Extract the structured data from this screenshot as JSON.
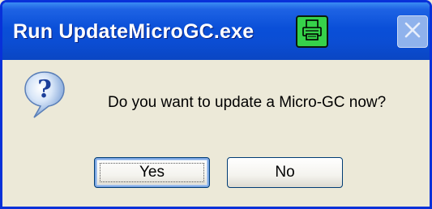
{
  "window": {
    "title": "Run UpdateMicroGC.exe"
  },
  "titlebar": {
    "extra_icon": "printer-icon",
    "close_icon": "close-icon"
  },
  "dialog": {
    "icon": "question-icon",
    "message": "Do you want to update a Micro-GC now?",
    "buttons": {
      "yes_label": "Yes",
      "no_label": "No"
    }
  },
  "colors": {
    "titlebar": "#0a4fd8",
    "window_bg": "#ece9d8",
    "printer_button": "#36d24a",
    "close_button": "#8fb2ec"
  }
}
